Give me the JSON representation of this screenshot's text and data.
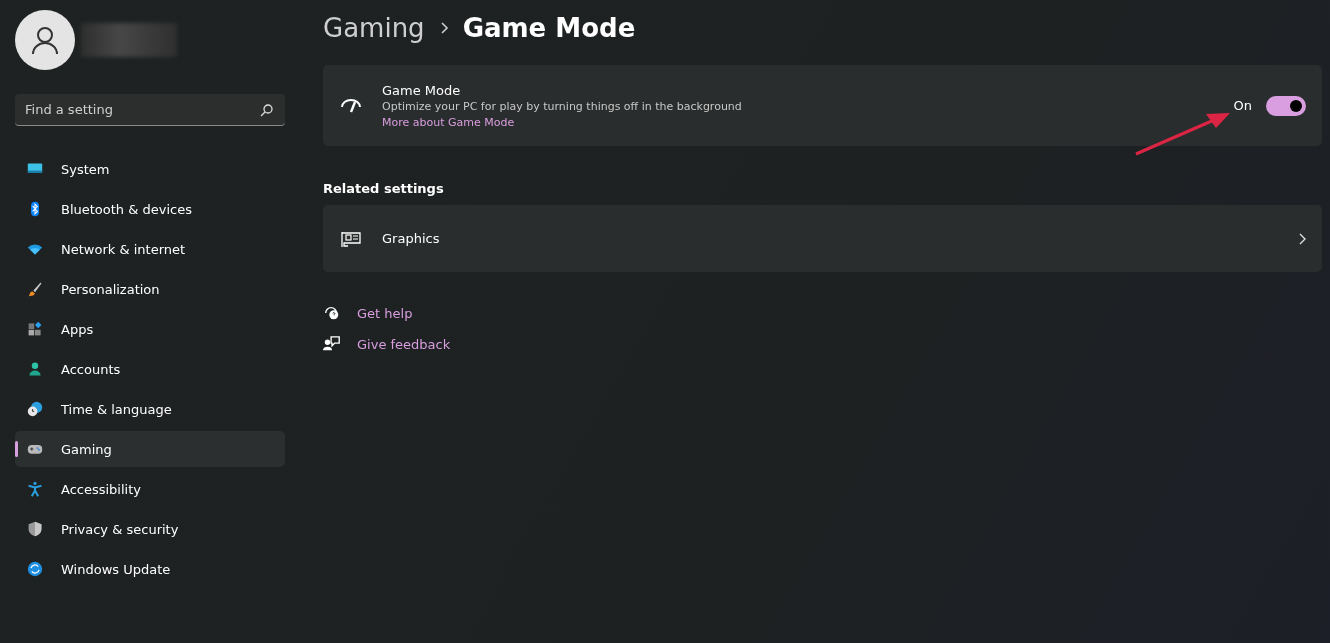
{
  "sidebar": {
    "search": {
      "placeholder": "Find a setting"
    },
    "items": [
      {
        "label": "System",
        "selected": false
      },
      {
        "label": "Bluetooth & devices",
        "selected": false
      },
      {
        "label": "Network & internet",
        "selected": false
      },
      {
        "label": "Personalization",
        "selected": false
      },
      {
        "label": "Apps",
        "selected": false
      },
      {
        "label": "Accounts",
        "selected": false
      },
      {
        "label": "Time & language",
        "selected": false
      },
      {
        "label": "Gaming",
        "selected": true
      },
      {
        "label": "Accessibility",
        "selected": false
      },
      {
        "label": "Privacy & security",
        "selected": false
      },
      {
        "label": "Windows Update",
        "selected": false
      }
    ]
  },
  "breadcrumb": [
    "Gaming",
    "Game Mode"
  ],
  "game_mode": {
    "title": "Game Mode",
    "description": "Optimize your PC for play by turning things off in the background",
    "link": "More about Game Mode",
    "state_label": "On",
    "on": true
  },
  "related": {
    "heading": "Related settings",
    "items": [
      {
        "label": "Graphics"
      }
    ]
  },
  "help_links": [
    {
      "label": "Get help"
    },
    {
      "label": "Give feedback"
    }
  ]
}
